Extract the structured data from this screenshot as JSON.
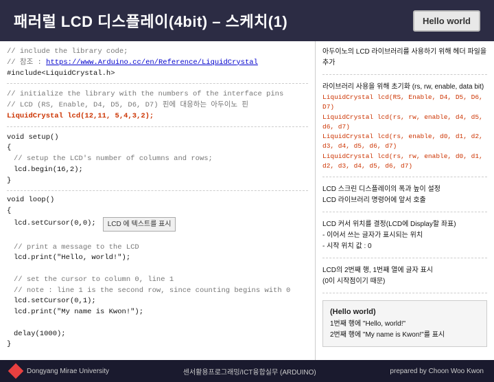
{
  "header": {
    "title": "패러럴 LCD 디스플레이(4bit) – 스케치(1)",
    "hello_world_badge": "Hello world"
  },
  "left_panel": {
    "section1": {
      "comment1": "// include the library code;",
      "comment2": "// 참조 : https://www.Arduino.cc/en/Reference/LiquidCrystal",
      "include": "#include<LiquidCrystal.h>"
    },
    "section2": {
      "comment1": "// initialize the library with the numbers of the interface pins",
      "comment2": "// LCD (RS, Enable, D4, D5, D6, D7) 핀에 대응하는 아두이노 핀",
      "code": "LiquidCrystal lcd(12,11, 5,4,3,2);"
    },
    "section3": {
      "code1": "void setup()",
      "code2": "{",
      "comment": "// setup the LCD's number of columns and rows;",
      "code3": "lcd.begin(16,2);",
      "code4": "}"
    },
    "section4": {
      "code1": "void loop()",
      "code2": "{",
      "label": "LCD 에 텍스트를 표시",
      "code3": "lcd.setCursor(0,0);",
      "blank": "",
      "comment1": "// print a message to the LCD",
      "code4": "lcd.print(\"Hello, world!\");",
      "blank2": "",
      "comment2": "// set the cursor to column 0, line 1",
      "comment3": "// note : line 1 is the second row, since counting begins with 0",
      "code5": "lcd.setCursor(0,1);",
      "code6": "lcd.print(\"My name is Kwon!\");",
      "blank3": "",
      "code7": "delay(1000);",
      "code8": "}"
    }
  },
  "right_panel": {
    "section1": {
      "text": "아두이노의 LCD 라이브러리를 사용하기 위해 헤더 파일을 추가"
    },
    "section2": {
      "title": "라이브러리 사용을 위해 초기화 (rs, rw, enable, data bit)",
      "code1": "LiquidCrystal lcd(RS, Enable, D4, D5, D6, D7)",
      "code2": "LiquidCrystal lcd(rs, rw, enable, d4, d5, d6, d7)",
      "code3": "LiquidCrystal lcd(rs, enable, d0, d1, d2, d3, d4, d5, d6, d7)",
      "code4": "LiquidCrystal lcd(rs, rw, enable, d0, d1, d2, d3, d4, d5, d6, d7)"
    },
    "section3": {
      "line1": "LCD 스크린 디스플레이의 폭과 높이 설정",
      "line2": "LCD 라이브러리 명령어에 앞서 호출"
    },
    "section4": {
      "line1": "LCD 커서 위치를 결정(LCD에 Display할 좌표)",
      "line2": "- 이어서 쓰는 글자가 표시되는 위치",
      "line3": "- 시작 위치 값 : 0"
    },
    "section5": {
      "line1": "LCD의 2번째 행, 1번째 열에 글자 표시",
      "line2": "(0이 시작점이기 때문)"
    },
    "result_box": {
      "title": "(Hello world)",
      "line1": "1번째 행에 \"Hello, world!\"",
      "line2": "2번째 행에 \"My name is Kwon!\"를 표시"
    }
  },
  "footer": {
    "university": "Dongyang Mirae University",
    "subject": "센서활용프로그래밍/ICT융합실무 (ARDUINO)",
    "prepared": "prepared by Choon Woo Kwon"
  }
}
